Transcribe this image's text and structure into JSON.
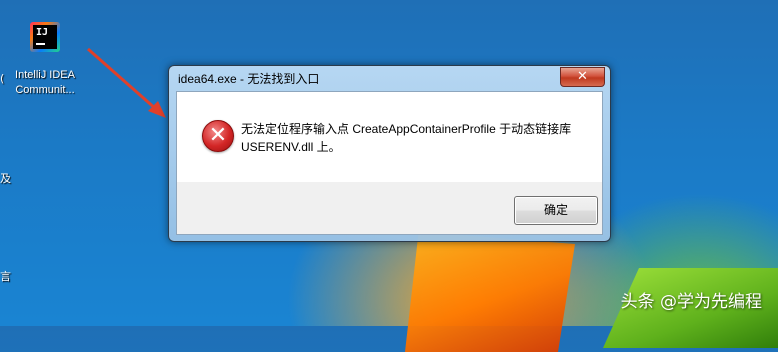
{
  "desktop": {
    "icon": {
      "name": "intellij-idea-icon",
      "logo_text": "IJ",
      "label_line1": "IntelliJ IDEA",
      "label_line2": "Communit..."
    },
    "left_edge_fragments": [
      "(",
      "及",
      "言"
    ]
  },
  "dialog": {
    "title": "idea64.exe - 无法找到入口",
    "close_label": "✕",
    "icon": "error-icon",
    "message_line1": "无法定位程序输入点 CreateAppContainerProfile 于动态链接库",
    "message_line2": "USERENV.dll 上。",
    "ok_label": "确定"
  },
  "annotation": {
    "arrow_color": "#e0402a"
  },
  "watermark": "头条 @学为先编程"
}
